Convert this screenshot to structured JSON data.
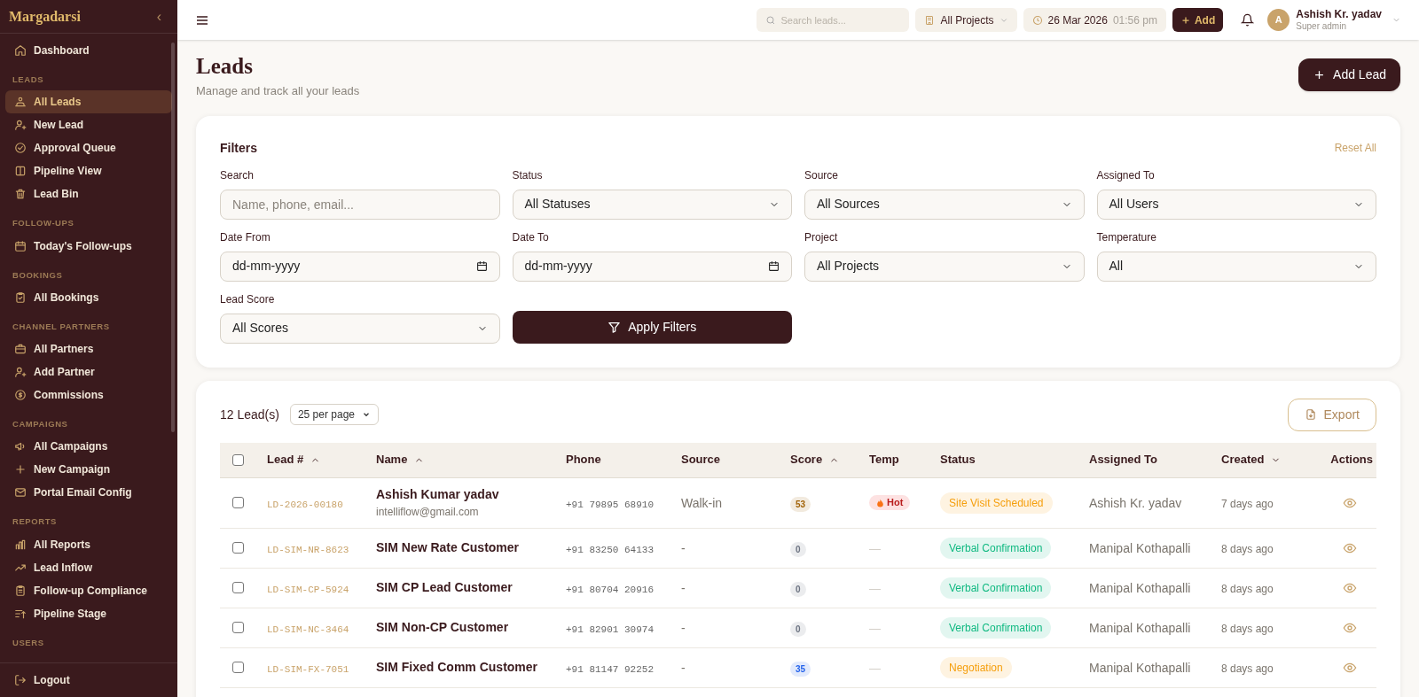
{
  "sidebar": {
    "brand": "Margadarsi",
    "collapse": "‹",
    "items": [
      {
        "kind": "link",
        "label": "Dashboard",
        "selected": false
      },
      {
        "kind": "section",
        "label": "LEADS"
      },
      {
        "kind": "link",
        "label": "All Leads",
        "selected": true
      },
      {
        "kind": "link",
        "label": "New Lead",
        "selected": false
      },
      {
        "kind": "link",
        "label": "Approval Queue",
        "selected": false
      },
      {
        "kind": "link",
        "label": "Pipeline View",
        "selected": false
      },
      {
        "kind": "link",
        "label": "Lead Bin",
        "selected": false
      },
      {
        "kind": "section",
        "label": "FOLLOW-UPS"
      },
      {
        "kind": "link",
        "label": "Today's Follow-ups",
        "selected": false
      },
      {
        "kind": "section",
        "label": "BOOKINGS"
      },
      {
        "kind": "link",
        "label": "All Bookings",
        "selected": false
      },
      {
        "kind": "section",
        "label": "CHANNEL PARTNERS"
      },
      {
        "kind": "link",
        "label": "All Partners",
        "selected": false
      },
      {
        "kind": "link",
        "label": "Add Partner",
        "selected": false
      },
      {
        "kind": "link",
        "label": "Commissions",
        "selected": false
      },
      {
        "kind": "section",
        "label": "CAMPAIGNS"
      },
      {
        "kind": "link",
        "label": "All Campaigns",
        "selected": false
      },
      {
        "kind": "link",
        "label": "New Campaign",
        "selected": false
      },
      {
        "kind": "link",
        "label": "Portal Email Config",
        "selected": false
      },
      {
        "kind": "section",
        "label": "REPORTS"
      },
      {
        "kind": "link",
        "label": "All Reports",
        "selected": false
      },
      {
        "kind": "link",
        "label": "Lead Inflow",
        "selected": false
      },
      {
        "kind": "link",
        "label": "Follow-up Compliance",
        "selected": false
      },
      {
        "kind": "link",
        "label": "Pipeline Stage",
        "selected": false
      },
      {
        "kind": "section",
        "label": "USERS"
      }
    ],
    "logout": "Logout"
  },
  "topbar": {
    "search": {
      "placeholder": "Search leads..."
    },
    "project": "All Projects",
    "date": "26 Mar 2026",
    "time": "01:56 pm",
    "add": "Add",
    "user": {
      "initial": "A",
      "name": "Ashish Kr. yadav",
      "role": "Super admin"
    }
  },
  "page": {
    "title": "Leads",
    "subtitle": "Manage and track all your leads",
    "add_button": "Add Lead"
  },
  "filters": {
    "title": "Filters",
    "reset": "Reset All",
    "fields": [
      {
        "label": "Search",
        "kind": "input",
        "placeholder": "Name, phone, email..."
      },
      {
        "label": "Status",
        "kind": "select",
        "value": "All Statuses"
      },
      {
        "label": "Source",
        "kind": "select",
        "value": "All Sources"
      },
      {
        "label": "Assigned To",
        "kind": "select",
        "value": "All Users"
      },
      {
        "label": "Date From",
        "kind": "date",
        "value": "dd-mm-yyyy"
      },
      {
        "label": "Date To",
        "kind": "date",
        "value": "dd-mm-yyyy"
      },
      {
        "label": "Project",
        "kind": "select",
        "value": "All Projects"
      },
      {
        "label": "Temperature",
        "kind": "select",
        "value": "All"
      },
      {
        "label": "Lead Score",
        "kind": "select",
        "value": "All Scores"
      }
    ],
    "apply": "Apply Filters"
  },
  "table": {
    "count": "12 Lead(s)",
    "per_page": "25 per page",
    "export": "Export",
    "header_checked": false,
    "columns": [
      {
        "kind": "checkbox"
      },
      {
        "label": "Lead #",
        "kind": "sort_asc"
      },
      {
        "label": "Name",
        "kind": "sort_asc"
      },
      {
        "label": "Phone",
        "kind": "plain"
      },
      {
        "label": "Source",
        "kind": "plain"
      },
      {
        "label": "Score",
        "kind": "sort_asc"
      },
      {
        "label": "Temp",
        "kind": "plain"
      },
      {
        "label": "Status",
        "kind": "plain"
      },
      {
        "label": "Assigned To",
        "kind": "plain"
      },
      {
        "label": "Created",
        "kind": "sort_desc"
      },
      {
        "label": "Actions",
        "kind": "plain_right"
      }
    ],
    "rows": [
      {
        "checked": false,
        "lead_no": "LD-2026-00180",
        "name": "Ashish Kumar yadav",
        "email": "intelliflow@gmail.com",
        "phone": "+91 79895 68910",
        "source": "Walk-in",
        "score": {
          "text": "53",
          "color": "#a16207"
        },
        "temp": {
          "kind": "hot",
          "text": "Hot"
        },
        "status": {
          "text": "Site Visit Scheduled",
          "color": "#f59e0b"
        },
        "assigned": "Ashish Kr. yadav",
        "created": "7 days ago"
      },
      {
        "checked": false,
        "lead_no": "LD-SIM-NR-8623",
        "name": "SIM New Rate Customer",
        "phone": "+91 83250 64133",
        "source": "-",
        "score": {
          "text": "0",
          "color": "#6b7280"
        },
        "temp": {
          "kind": "none",
          "text": "—"
        },
        "status": {
          "text": "Verbal Confirmation",
          "color": "#10b981"
        },
        "assigned": "Manipal Kothapalli",
        "created": "8 days ago"
      },
      {
        "checked": false,
        "lead_no": "LD-SIM-CP-5924",
        "name": "SIM CP Lead Customer",
        "phone": "+91 80704 20916",
        "source": "-",
        "score": {
          "text": "0",
          "color": "#6b7280"
        },
        "temp": {
          "kind": "none",
          "text": "—"
        },
        "status": {
          "text": "Verbal Confirmation",
          "color": "#10b981"
        },
        "assigned": "Manipal Kothapalli",
        "created": "8 days ago"
      },
      {
        "checked": false,
        "lead_no": "LD-SIM-NC-3464",
        "name": "SIM Non-CP Customer",
        "phone": "+91 82901 30974",
        "source": "-",
        "score": {
          "text": "0",
          "color": "#6b7280"
        },
        "temp": {
          "kind": "none",
          "text": "—"
        },
        "status": {
          "text": "Verbal Confirmation",
          "color": "#10b981"
        },
        "assigned": "Manipal Kothapalli",
        "created": "8 days ago"
      },
      {
        "checked": false,
        "lead_no": "LD-SIM-FX-7051",
        "name": "SIM Fixed Comm Customer",
        "phone": "+91 81147 92252",
        "source": "-",
        "score": {
          "text": "35",
          "color": "#2563eb"
        },
        "temp": {
          "kind": "none",
          "text": "—"
        },
        "status": {
          "text": "Negotiation",
          "color": "#f59e0b"
        },
        "assigned": "Manipal Kothapalli",
        "created": "8 days ago"
      }
    ]
  }
}
